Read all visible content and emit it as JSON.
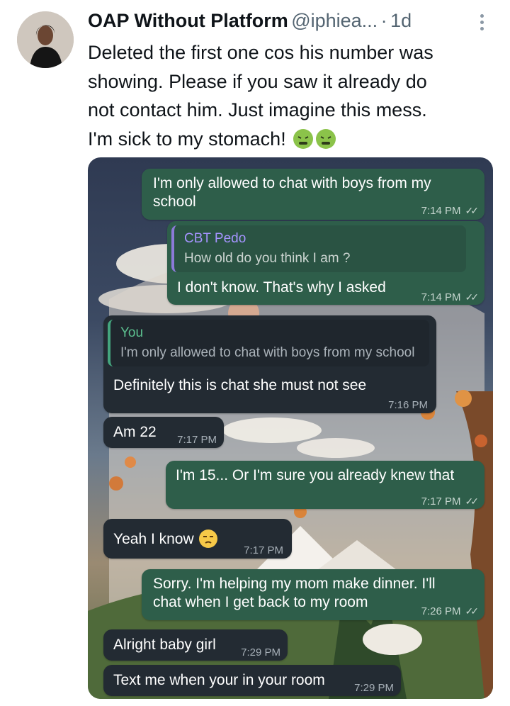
{
  "tweet": {
    "display_name": "OAP Without Platform",
    "handle": "@iphiea...",
    "separator": "·",
    "time_ago": "1d",
    "text": "Deleted the first one cos his number was\nshowing. Please if you saw it already do\nnot contact him. Just imagine this mess.\nI'm sick to my stomach!",
    "emoji_names": [
      "nauseated-face",
      "nauseated-face"
    ]
  },
  "chat": {
    "messages": [
      {
        "direction": "out",
        "text": "I'm only allowed to chat with boys from my\nschool",
        "time": "7:14 PM"
      },
      {
        "direction": "out",
        "quote_name": "CBT Pedo",
        "quote_text": "How old do you think I am ?",
        "text": "I don't know. That's why I asked",
        "time": "7:14 PM"
      },
      {
        "direction": "in",
        "quote_name": "You",
        "quote_text": "I'm only allowed to chat with boys from my school",
        "text": "Definitely this is chat she must not see",
        "time": "7:16 PM"
      },
      {
        "direction": "in",
        "text": "Am 22",
        "time": "7:17 PM"
      },
      {
        "direction": "out",
        "text": "I'm 15... Or I'm sure you already knew that",
        "time": "7:17 PM"
      },
      {
        "direction": "in",
        "text": "Yeah I know",
        "emoji": "unamused-face",
        "time": "7:17 PM"
      },
      {
        "direction": "out",
        "text": "Sorry. I'm helping my mom make dinner. I'll\nchat when I get back to my room",
        "time": "7:26 PM"
      },
      {
        "direction": "in",
        "text": "Alright baby girl",
        "time": "7:29 PM"
      },
      {
        "direction": "in",
        "text": "Text me when your in your room",
        "time": "7:29 PM"
      }
    ],
    "read_receipt": "double-check"
  }
}
